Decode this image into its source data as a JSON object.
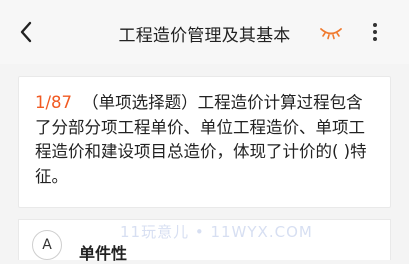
{
  "header": {
    "title": "工程造价管理及其基本",
    "back_icon": "chevron-left-icon",
    "eye_icon": "closed-eye-icon",
    "more_icon": "vertical-dots-icon"
  },
  "question": {
    "number": "1/87",
    "text": "（单项选择题）工程造价计算过程包含了分部分项工程单价、单位工程造价、单项工程造价和建设项目总造价，体现了计价的( )特征。"
  },
  "options": [
    {
      "letter": "A",
      "text": "单件性"
    }
  ],
  "watermark": "11玩意儿 • 11WYX.COM",
  "colors": {
    "accent": "#f15a22",
    "eye": "#f07a2e",
    "background": "#f4f4f4"
  }
}
